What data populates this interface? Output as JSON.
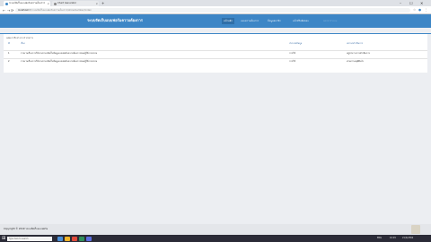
{
  "browser": {
    "tabs": [
      {
        "title": "ระบบจัดเก็บแบบฟอร์มความต้องการ",
        "active": true
      },
      {
        "title": "Chart Generator",
        "active": false
      }
    ],
    "new_tab": "+",
    "window_controls": {
      "minimize": "–",
      "maximize": "☐",
      "close": "✕"
    },
    "nav": {
      "back": "←",
      "forward": "→",
      "reload": "⟳"
    },
    "url_host": "localhost",
    "url_path": ":8/ระบบจัดเก็บแบบฟอร์มความต้องการ/showmember/index",
    "addr_icons": {
      "star": "☆",
      "profile": "●",
      "menu": "⋮"
    }
  },
  "app": {
    "brand": "ระบบจัดเก็บแบบฟอร์มความต้องการ",
    "nav": [
      {
        "label": "หน้าหลัก",
        "state": "active"
      },
      {
        "label": "แบบความต้องการ",
        "state": "normal"
      },
      {
        "label": "ข้อมูลสมาชิก",
        "state": "normal"
      },
      {
        "label": "หน้าที่รับผิดชอบ",
        "state": "normal"
      },
      {
        "label": "ออกจากระบบ",
        "state": "disabled"
      }
    ],
    "accent": "#3d86c6"
  },
  "content": {
    "breadcrumb": "แสดง 1 ถึง 2 จาก 2 รายการ",
    "columns": {
      "no": "#",
      "title": "เรื่อง",
      "type": "ประเภทข้อมูล",
      "status": "สถานะดำเนินการ"
    },
    "rows": [
      {
        "no": "1",
        "title": "รายงานเรื่องการใช้งานระบบจัดเก็บข้อมูลแบบฟอร์มความต้องการของผู้ใช้งานระบบ",
        "type": "การใช้",
        "status": "อยู่ระหว่างการดำเนินการ"
      },
      {
        "no": "2",
        "title": "รายงานเรื่องการใช้งานระบบจัดเก็บข้อมูลแบบฟอร์มความต้องการของผู้ใช้งานระบบ",
        "type": "การใช้",
        "status": "ผ่านการอนุมัติแล้ว"
      }
    ]
  },
  "footer": {
    "copyright": "Copyright © 2019 ระบบจัดเก็บแบบฟอร์ม"
  },
  "taskbar": {
    "start": "⊞",
    "search_placeholder": "Type here to search",
    "tray_lang": "ENG",
    "tray_time": "10:45",
    "tray_date": "21/4/2562"
  }
}
